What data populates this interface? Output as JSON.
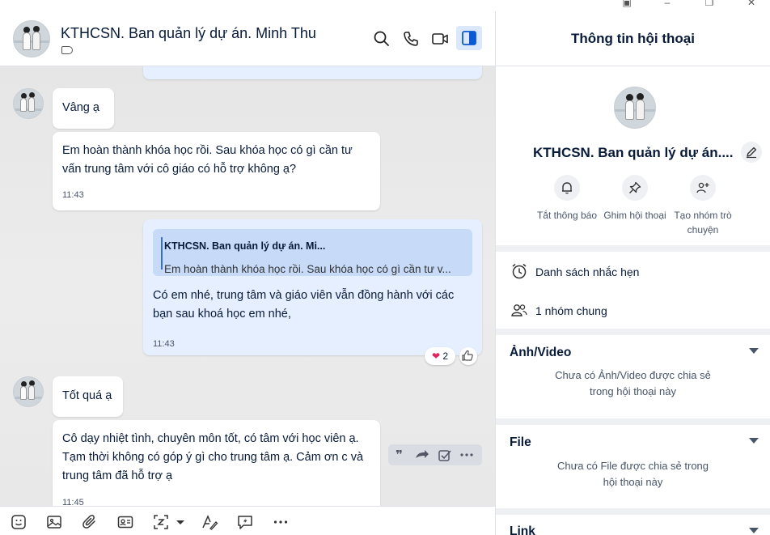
{
  "header": {
    "title": "KTHCSN. Ban quản lý dự án. Minh Thu"
  },
  "messages": [
    {
      "text": "Vâng ạ"
    },
    {
      "text": "Em hoàn thành khóa học rồi. Sau khóa học có gì cần tư vấn trung tâm với cô giáo có hỗ trợ không ạ?",
      "time": "11:43"
    },
    {
      "quote_name": "KTHCSN. Ban quản lý dự án. Mi...",
      "quote_text": "Em hoàn thành khóa học rồi. Sau khóa học có gì cần tư v...",
      "text": "Có em nhé, trung tâm và giáo viên vẫn đồng hành với các bạn sau khoá học em nhé,",
      "time": "11:43",
      "reaction_count": "2"
    },
    {
      "text": "Tốt quá ạ"
    },
    {
      "text": "Cô dạy nhiệt tình, chuyên môn tốt, có tâm với học viên ạ. Tạm thời không có góp ý gì cho trung tâm ạ. Cảm ơn c và trung tâm đã hỗ trợ ạ",
      "time": "11:45"
    }
  ],
  "info": {
    "title": "Thông tin hội thoại",
    "name": "KTHCSN. Ban quản lý dự án....",
    "actions": [
      {
        "label": "Tắt thông báo",
        "icon": "bell-icon"
      },
      {
        "label": "Ghim hội thoại",
        "icon": "pin-icon"
      },
      {
        "label": "Tạo nhóm trò chuyện",
        "icon": "add-group-icon"
      }
    ],
    "reminders": "Danh sách nhắc hẹn",
    "common_groups": "1 nhóm chung",
    "media_title": "Ảnh/Video",
    "media_empty": "Chưa có Ảnh/Video được chia sẻ trong hội thoại này",
    "file_title": "File",
    "file_empty": "Chưa có File được chia sẻ trong hội thoại này",
    "link_title": "Link"
  },
  "colors": {
    "accent": "#0068ff",
    "my_bubble": "#e5efff",
    "quote_bg": "#c7dbf9"
  }
}
